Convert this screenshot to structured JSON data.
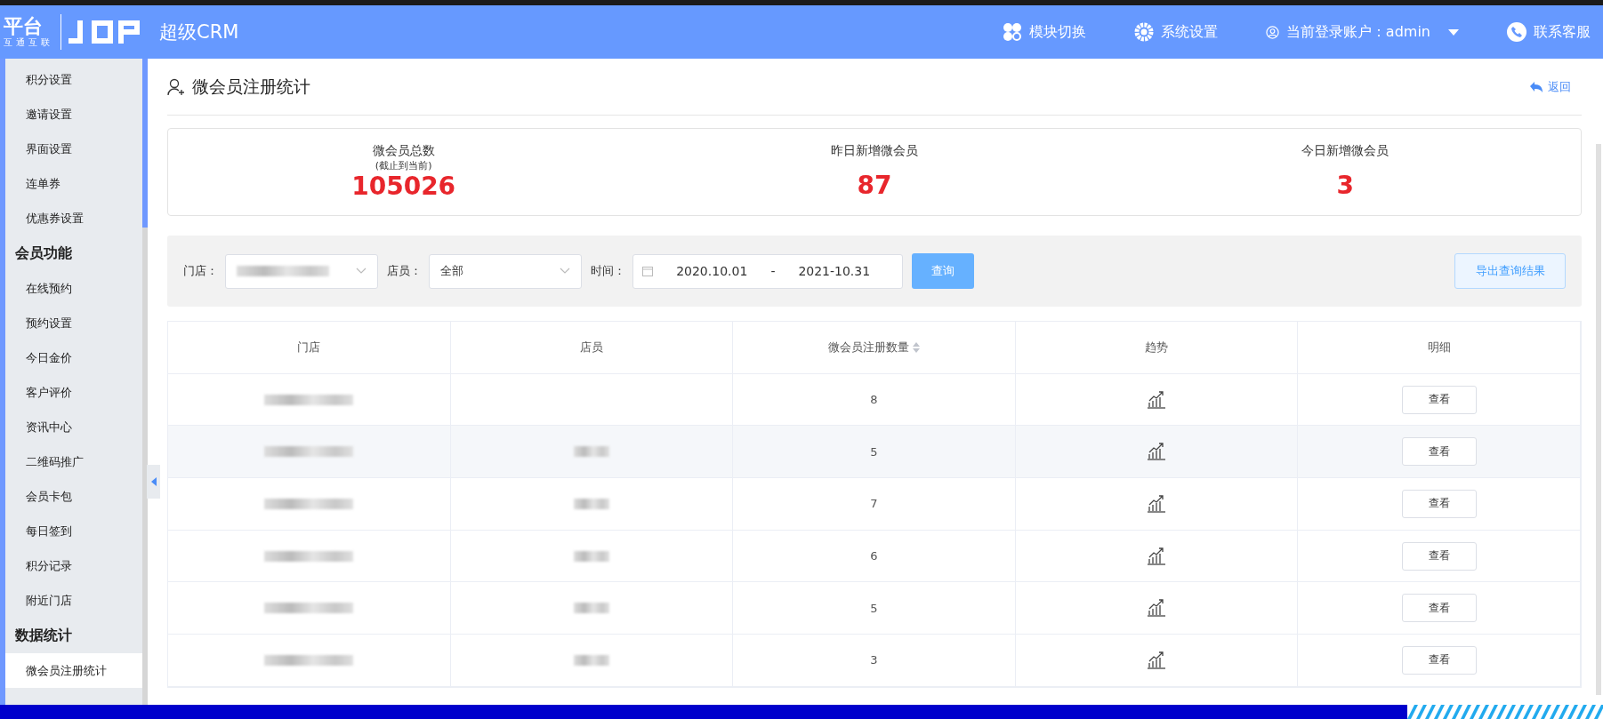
{
  "header": {
    "logo_text": "平台",
    "logo_sub": "互通互联",
    "app_title": "超级CRM",
    "nav": [
      {
        "kind": "modules",
        "label": "模块切换"
      },
      {
        "kind": "settings",
        "label": "系统设置"
      },
      {
        "kind": "account",
        "label": "当前登录账户：admin"
      },
      {
        "kind": "support",
        "label": "联系客服"
      }
    ]
  },
  "sidebar": {
    "items": [
      {
        "kind": "item",
        "label": "积分设置",
        "selected": false
      },
      {
        "kind": "item",
        "label": "邀请设置",
        "selected": false
      },
      {
        "kind": "item",
        "label": "界面设置",
        "selected": false
      },
      {
        "kind": "item",
        "label": "连单券",
        "selected": false
      },
      {
        "kind": "item",
        "label": "优惠券设置",
        "selected": false
      },
      {
        "kind": "group",
        "label": "会员功能",
        "selected": false
      },
      {
        "kind": "item",
        "label": "在线预约",
        "selected": false
      },
      {
        "kind": "item",
        "label": "预约设置",
        "selected": false
      },
      {
        "kind": "item",
        "label": "今日金价",
        "selected": false
      },
      {
        "kind": "item",
        "label": "客户评价",
        "selected": false
      },
      {
        "kind": "item",
        "label": "资讯中心",
        "selected": false
      },
      {
        "kind": "item",
        "label": "二维码推广",
        "selected": false
      },
      {
        "kind": "item",
        "label": "会员卡包",
        "selected": false
      },
      {
        "kind": "item",
        "label": "每日签到",
        "selected": false
      },
      {
        "kind": "item",
        "label": "积分记录",
        "selected": false
      },
      {
        "kind": "item",
        "label": "附近门店",
        "selected": false
      },
      {
        "kind": "group",
        "label": "数据统计",
        "selected": false
      },
      {
        "kind": "item",
        "label": "微会员注册统计",
        "selected": true
      }
    ]
  },
  "page": {
    "title": "微会员注册统计",
    "back": "返回"
  },
  "stats": [
    {
      "label": "微会员总数",
      "note": "(截止到当前)",
      "value": "105026"
    },
    {
      "label": "昨日新增微会员",
      "value": "87"
    },
    {
      "label": "今日新增微会员",
      "value": "3"
    }
  ],
  "filters": {
    "store_label": "门店：",
    "clerk_label": "店员：",
    "clerk_value": "全部",
    "time_label": "时间：",
    "date_from": "2020.10.01",
    "date_sep": "-",
    "date_to": "2021-10.31",
    "query_button": "查询",
    "export_button": "导出查询结果"
  },
  "table": {
    "columns": [
      {
        "label": "门店",
        "sortable": false
      },
      {
        "label": "店员",
        "sortable": false
      },
      {
        "label": "微会员注册数量",
        "sortable": true
      },
      {
        "label": "趋势",
        "sortable": false
      },
      {
        "label": "明细",
        "sortable": false
      }
    ],
    "rows": [
      {
        "clerk_blurred": false,
        "count": "8",
        "action": "查看",
        "highlighted": false
      },
      {
        "clerk_blurred": true,
        "count": "5",
        "action": "查看",
        "highlighted": true
      },
      {
        "clerk_blurred": true,
        "count": "7",
        "action": "查看",
        "highlighted": false
      },
      {
        "clerk_blurred": true,
        "count": "6",
        "action": "查看",
        "highlighted": false
      },
      {
        "clerk_blurred": true,
        "count": "5",
        "action": "查看",
        "highlighted": false
      },
      {
        "clerk_blurred": true,
        "count": "3",
        "action": "查看",
        "highlighted": false
      }
    ]
  }
}
